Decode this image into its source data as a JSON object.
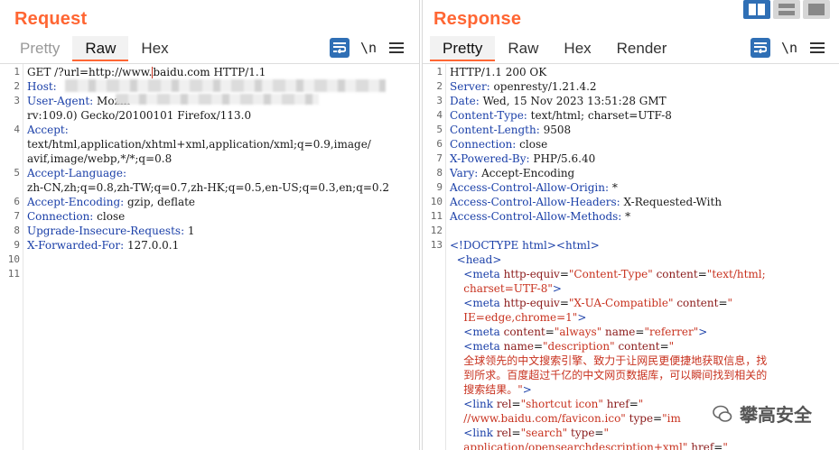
{
  "request": {
    "title": "Request",
    "tabs": [
      {
        "label": "Pretty",
        "active": false
      },
      {
        "label": "Raw",
        "active": true
      },
      {
        "label": "Hex",
        "active": false
      }
    ],
    "newline_toggle": "\\n",
    "lines": [
      {
        "n": "1",
        "parts": [
          [
            "t",
            "GET /?"
          ],
          [
            "u",
            "url=http://www."
          ],
          [
            "cur",
            ""
          ],
          [
            "u",
            "baidu.com"
          ],
          [
            "t",
            " HTTP/1.1"
          ]
        ]
      },
      {
        "n": "2",
        "parts": [
          [
            "h",
            "Host:"
          ]
        ]
      },
      {
        "n": "3",
        "parts": [
          [
            "h",
            "User-Agent:"
          ],
          [
            "t",
            " Mozill"
          ]
        ]
      },
      {
        "n": "",
        "parts": [
          [
            "t",
            "rv:109.0) Gecko/20100101 Firefox/113.0"
          ]
        ]
      },
      {
        "n": "4",
        "parts": [
          [
            "h",
            "Accept:"
          ]
        ]
      },
      {
        "n": "",
        "parts": [
          [
            "t",
            "text/html,application/xhtml+xml,application/xml;q=0.9,image/"
          ]
        ]
      },
      {
        "n": "",
        "parts": [
          [
            "t",
            "avif,image/webp,*/*;q=0.8"
          ]
        ]
      },
      {
        "n": "5",
        "parts": [
          [
            "h",
            "Accept-Language:"
          ]
        ]
      },
      {
        "n": "",
        "parts": [
          [
            "t",
            "zh-CN,zh;q=0.8,zh-TW;q=0.7,zh-HK;q=0.5,en-US;q=0.3,en;q=0.2"
          ]
        ]
      },
      {
        "n": "6",
        "parts": [
          [
            "h",
            "Accept-Encoding:"
          ],
          [
            "t",
            " gzip, deflate"
          ]
        ]
      },
      {
        "n": "7",
        "parts": [
          [
            "h",
            "Connection:"
          ],
          [
            "t",
            " close"
          ]
        ]
      },
      {
        "n": "8",
        "parts": [
          [
            "h",
            "Upgrade-Insecure-Requests:"
          ],
          [
            "t",
            " 1"
          ]
        ]
      },
      {
        "n": "9",
        "parts": [
          [
            "h",
            "X-Forwarded-For:"
          ],
          [
            "t",
            " 127.0.0.1"
          ]
        ]
      },
      {
        "n": "10",
        "parts": []
      },
      {
        "n": "11",
        "parts": []
      }
    ]
  },
  "response": {
    "title": "Response",
    "tabs": [
      {
        "label": "Pretty",
        "active": true
      },
      {
        "label": "Raw",
        "active": false
      },
      {
        "label": "Hex",
        "active": false
      },
      {
        "label": "Render",
        "active": false
      }
    ],
    "newline_toggle": "\\n",
    "lines": [
      {
        "n": "1",
        "parts": [
          [
            "t",
            "HTTP/1.1 200 OK"
          ]
        ]
      },
      {
        "n": "2",
        "parts": [
          [
            "h",
            "Server:"
          ],
          [
            "t",
            " openresty/1.21.4.2"
          ]
        ]
      },
      {
        "n": "3",
        "parts": [
          [
            "h",
            "Date:"
          ],
          [
            "t",
            " Wed, 15 Nov 2023 13:51:28 GMT"
          ]
        ]
      },
      {
        "n": "4",
        "parts": [
          [
            "h",
            "Content-Type:"
          ],
          [
            "t",
            " text/html; charset=UTF-8"
          ]
        ]
      },
      {
        "n": "5",
        "parts": [
          [
            "h",
            "Content-Length:"
          ],
          [
            "t",
            " 9508"
          ]
        ]
      },
      {
        "n": "6",
        "parts": [
          [
            "h",
            "Connection:"
          ],
          [
            "t",
            " close"
          ]
        ]
      },
      {
        "n": "7",
        "parts": [
          [
            "h",
            "X-Powered-By:"
          ],
          [
            "t",
            " PHP/5.6.40"
          ]
        ]
      },
      {
        "n": "8",
        "parts": [
          [
            "h",
            "Vary:"
          ],
          [
            "t",
            " Accept-Encoding"
          ]
        ]
      },
      {
        "n": "9",
        "parts": [
          [
            "h",
            "Access-Control-Allow-Origin:"
          ],
          [
            "t",
            " *"
          ]
        ]
      },
      {
        "n": "10",
        "parts": [
          [
            "h",
            "Access-Control-Allow-Headers:"
          ],
          [
            "t",
            " X-Requested-With"
          ]
        ]
      },
      {
        "n": "11",
        "parts": [
          [
            "h",
            "Access-Control-Allow-Methods:"
          ],
          [
            "t",
            " *"
          ]
        ]
      },
      {
        "n": "12",
        "parts": []
      },
      {
        "n": "13",
        "parts": [
          [
            "g",
            "<!DOCTYPE html><html>"
          ]
        ]
      },
      {
        "n": "",
        "parts": [
          [
            "t",
            "  "
          ],
          [
            "g",
            "<head>"
          ]
        ]
      },
      {
        "n": "",
        "parts": [
          [
            "t",
            "    "
          ],
          [
            "g",
            "<meta "
          ],
          [
            "a",
            "http-equiv"
          ],
          [
            "t",
            "="
          ],
          [
            "v",
            "\"Content-Type\""
          ],
          [
            "t",
            " "
          ],
          [
            "a",
            "content"
          ],
          [
            "t",
            "="
          ],
          [
            "v",
            "\"text/html;"
          ]
        ]
      },
      {
        "n": "",
        "parts": [
          [
            "t",
            "    "
          ],
          [
            "v",
            "charset=UTF-8\""
          ],
          [
            "g",
            ">"
          ]
        ]
      },
      {
        "n": "",
        "parts": [
          [
            "t",
            "    "
          ],
          [
            "g",
            "<meta "
          ],
          [
            "a",
            "http-equiv"
          ],
          [
            "t",
            "="
          ],
          [
            "v",
            "\"X-UA-Compatible\""
          ],
          [
            "t",
            " "
          ],
          [
            "a",
            "content"
          ],
          [
            "t",
            "="
          ],
          [
            "v",
            "\""
          ]
        ]
      },
      {
        "n": "",
        "parts": [
          [
            "t",
            "    "
          ],
          [
            "v",
            "IE=edge,chrome=1\""
          ],
          [
            "g",
            ">"
          ]
        ]
      },
      {
        "n": "",
        "parts": [
          [
            "t",
            "    "
          ],
          [
            "g",
            "<meta "
          ],
          [
            "a",
            "content"
          ],
          [
            "t",
            "="
          ],
          [
            "v",
            "\"always\""
          ],
          [
            "t",
            " "
          ],
          [
            "a",
            "name"
          ],
          [
            "t",
            "="
          ],
          [
            "v",
            "\"referrer\""
          ],
          [
            "g",
            ">"
          ]
        ]
      },
      {
        "n": "",
        "parts": [
          [
            "t",
            "    "
          ],
          [
            "g",
            "<meta "
          ],
          [
            "a",
            "name"
          ],
          [
            "t",
            "="
          ],
          [
            "v",
            "\"description\""
          ],
          [
            "t",
            " "
          ],
          [
            "a",
            "content"
          ],
          [
            "t",
            "="
          ],
          [
            "v",
            "\""
          ]
        ]
      },
      {
        "n": "",
        "parts": [
          [
            "t",
            "    "
          ],
          [
            "v",
            "全球领先的中文搜索引擎、致力于让网民更便捷地获取信息，找"
          ]
        ]
      },
      {
        "n": "",
        "parts": [
          [
            "t",
            "    "
          ],
          [
            "v",
            "到所求。百度超过千亿的中文网页数据库，可以瞬间找到相关的"
          ]
        ]
      },
      {
        "n": "",
        "parts": [
          [
            "t",
            "    "
          ],
          [
            "v",
            "搜索结果。\""
          ],
          [
            "g",
            ">"
          ]
        ]
      },
      {
        "n": "",
        "parts": [
          [
            "t",
            "    "
          ],
          [
            "g",
            "<link "
          ],
          [
            "a",
            "rel"
          ],
          [
            "t",
            "="
          ],
          [
            "v",
            "\"shortcut icon\""
          ],
          [
            "t",
            " "
          ],
          [
            "a",
            "href"
          ],
          [
            "t",
            "="
          ],
          [
            "v",
            "\""
          ]
        ]
      },
      {
        "n": "",
        "parts": [
          [
            "t",
            "    "
          ],
          [
            "v",
            "//www.baidu.com/favicon.ico\""
          ],
          [
            "t",
            " "
          ],
          [
            "a",
            "type"
          ],
          [
            "t",
            "="
          ],
          [
            "v",
            "\"im"
          ]
        ]
      },
      {
        "n": "",
        "parts": [
          [
            "t",
            "    "
          ],
          [
            "g",
            "<link "
          ],
          [
            "a",
            "rel"
          ],
          [
            "t",
            "="
          ],
          [
            "v",
            "\"search\""
          ],
          [
            "t",
            " "
          ],
          [
            "a",
            "type"
          ],
          [
            "t",
            "="
          ],
          [
            "v",
            "\""
          ]
        ]
      },
      {
        "n": "",
        "parts": [
          [
            "t",
            "    "
          ],
          [
            "v",
            "application/opensearchdescription+xml\""
          ],
          [
            "t",
            " "
          ],
          [
            "a",
            "href"
          ],
          [
            "t",
            "="
          ],
          [
            "v",
            "\""
          ]
        ]
      }
    ]
  },
  "watermark": {
    "text": "攀高安全"
  },
  "colors": {
    "accent": "#ff6633",
    "tool_blue": "#2f6fb5"
  }
}
